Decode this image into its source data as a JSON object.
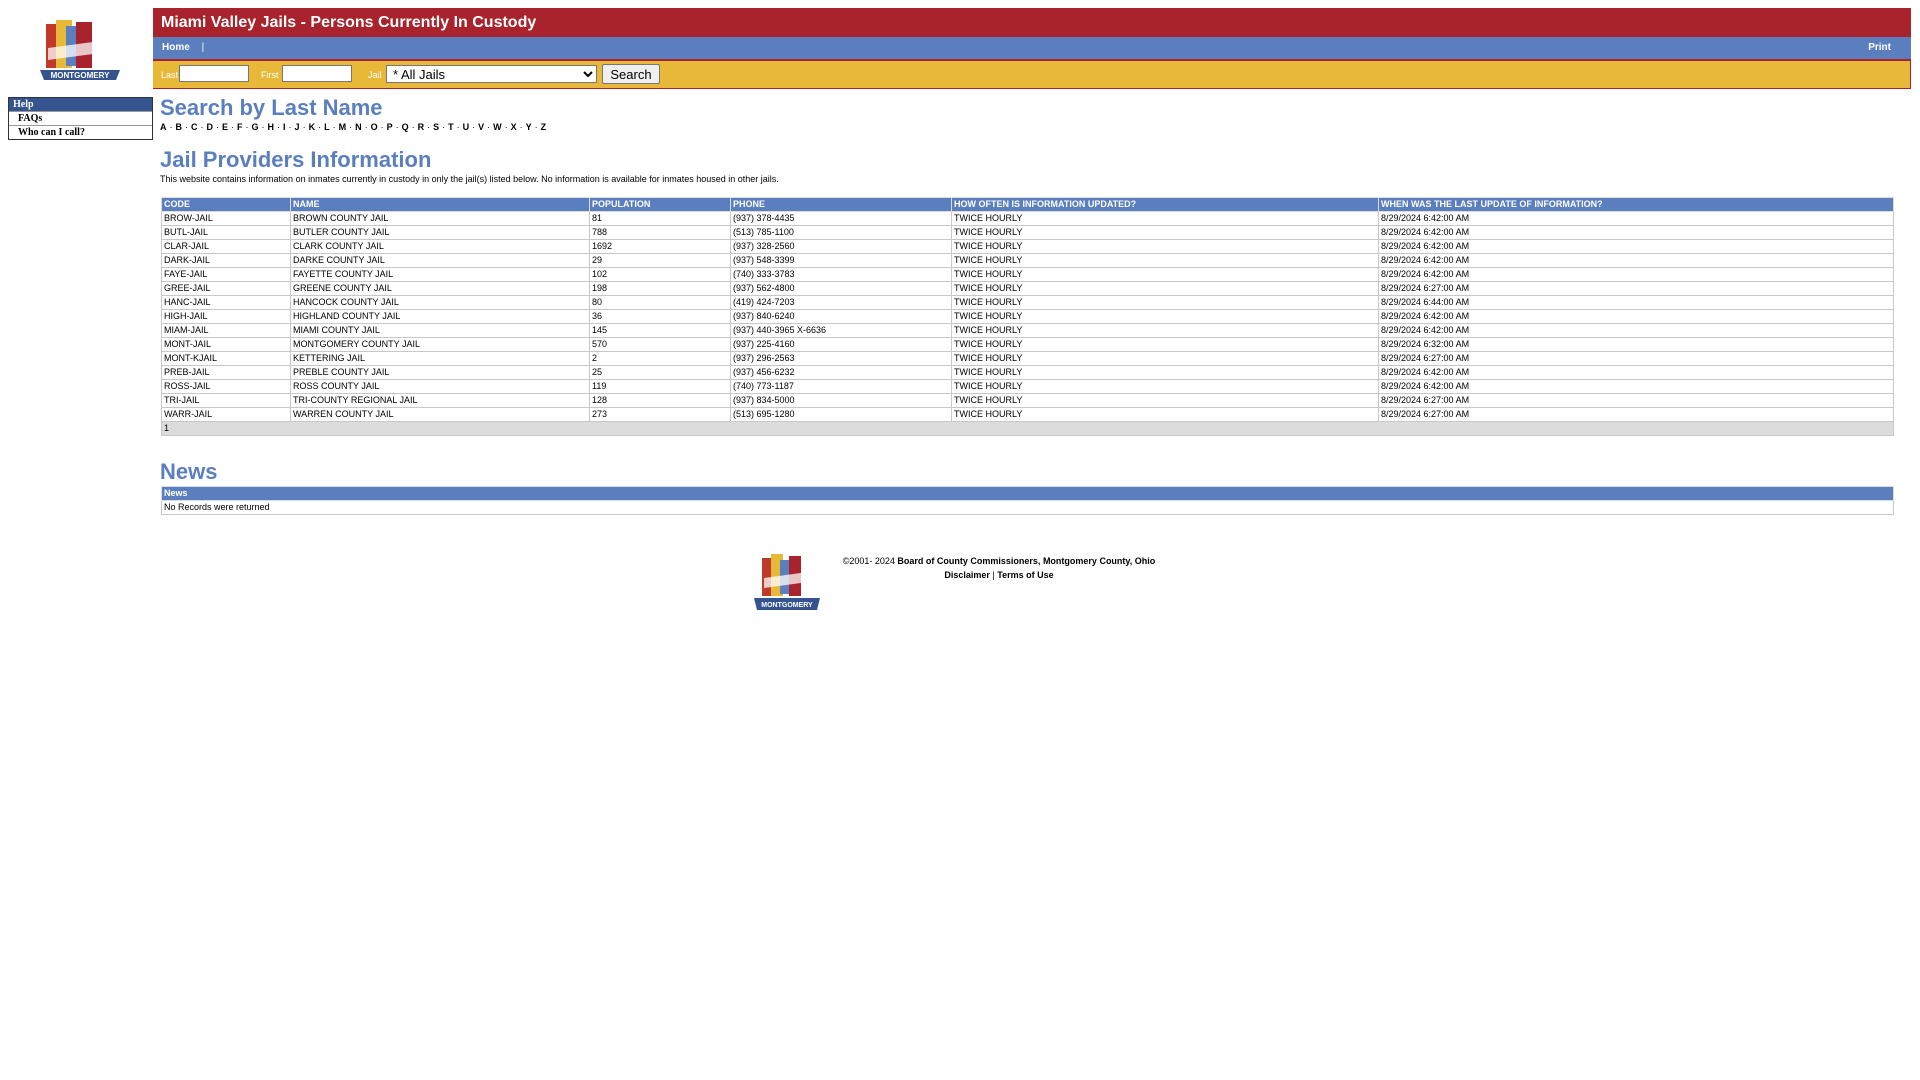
{
  "header": {
    "title": "Miami Valley Jails - Persons Currently In Custody",
    "logo_text": "MONTGOMERY"
  },
  "nav": {
    "home": "Home",
    "separator": "|",
    "print": "Print"
  },
  "search": {
    "last_label": "Last",
    "first_label": "First",
    "jail_label": "Jail",
    "jail_selected": "* All Jails",
    "button": "Search"
  },
  "side_menu": {
    "heading": "Help",
    "items": [
      "FAQs",
      "Who can I call?"
    ]
  },
  "search_by_name": {
    "heading": "Search by Last Name",
    "letters": [
      "A",
      "B",
      "C",
      "D",
      "E",
      "F",
      "G",
      "H",
      "I",
      "J",
      "K",
      "L",
      "M",
      "N",
      "O",
      "P",
      "Q",
      "R",
      "S",
      "T",
      "U",
      "V",
      "W",
      "X",
      "Y",
      "Z"
    ],
    "separator": "·"
  },
  "providers": {
    "heading": "Jail Providers Information",
    "description": "This website contains information on inmates currently in custody in only the jail(s) listed below. No information is available for inmates housed in other jails.",
    "columns": [
      "CODE",
      "NAME",
      "POPULATION",
      "PHONE",
      "HOW OFTEN IS INFORMATION UPDATED?",
      "WHEN WAS THE LAST UPDATE OF INFORMATION?"
    ],
    "rows": [
      [
        "BROW-JAIL",
        "BROWN COUNTY JAIL",
        "81",
        "(937) 378-4435",
        "TWICE HOURLY",
        "8/29/2024 6:42:00 AM"
      ],
      [
        "BUTL-JAIL",
        "BUTLER COUNTY JAIL",
        "788",
        "(513) 785-1100",
        "TWICE HOURLY",
        "8/29/2024 6:42:00 AM"
      ],
      [
        "CLAR-JAIL",
        "CLARK COUNTY JAIL",
        "1692",
        "(937) 328-2560",
        "TWICE HOURLY",
        "8/29/2024 6:42:00 AM"
      ],
      [
        "DARK-JAIL",
        "DARKE COUNTY JAIL",
        "29",
        "(937) 548-3399",
        "TWICE HOURLY",
        "8/29/2024 6:42:00 AM"
      ],
      [
        "FAYE-JAIL",
        "FAYETTE COUNTY JAIL",
        "102",
        "(740) 333-3783",
        "TWICE HOURLY",
        "8/29/2024 6:42:00 AM"
      ],
      [
        "GREE-JAIL",
        "GREENE COUNTY JAIL",
        "198",
        "(937) 562-4800",
        "TWICE HOURLY",
        "8/29/2024 6:27:00 AM"
      ],
      [
        "HANC-JAIL",
        "HANCOCK COUNTY JAIL",
        "80",
        "(419) 424-7203",
        "TWICE HOURLY",
        "8/29/2024 6:44:00 AM"
      ],
      [
        "HIGH-JAIL",
        "HIGHLAND COUNTY JAIL",
        "36",
        "(937) 840-6240",
        "TWICE HOURLY",
        "8/29/2024 6:42:00 AM"
      ],
      [
        "MIAM-JAIL",
        "MIAMI COUNTY JAIL",
        "145",
        "(937) 440-3965 X-6636",
        "TWICE HOURLY",
        "8/29/2024 6:42:00 AM"
      ],
      [
        "MONT-JAIL",
        "MONTGOMERY COUNTY JAIL",
        "570",
        "(937) 225-4160",
        "TWICE HOURLY",
        "8/29/2024 6:32:00 AM"
      ],
      [
        "MONT-KJAIL",
        "KETTERING JAIL",
        "2",
        "(937) 296-2563",
        "TWICE HOURLY",
        "8/29/2024 6:27:00 AM"
      ],
      [
        "PREB-JAIL",
        "PREBLE COUNTY JAIL",
        "25",
        "(937) 456-6232",
        "TWICE HOURLY",
        "8/29/2024 6:42:00 AM"
      ],
      [
        "ROSS-JAIL",
        "ROSS COUNTY JAIL",
        "119",
        "(740) 773-1187",
        "TWICE HOURLY",
        "8/29/2024 6:42:00 AM"
      ],
      [
        "TRI-JAIL",
        "TRI-COUNTY REGIONAL JAIL",
        "128",
        "(937) 834-5000",
        "TWICE HOURLY",
        "8/29/2024 6:27:00 AM"
      ],
      [
        "WARR-JAIL",
        "WARREN COUNTY JAIL",
        "273",
        "(513) 695-1280",
        "TWICE HOURLY",
        "8/29/2024 6:27:00 AM"
      ]
    ],
    "pager": "1"
  },
  "news": {
    "heading": "News",
    "column": "News",
    "empty": "No Records were returned"
  },
  "footer": {
    "copyright": "©2001- 2024",
    "org": "Board of County Commissioners, Montgomery County, Ohio",
    "disclaimer": "Disclaimer",
    "separator": "|",
    "terms": "Terms of Use"
  },
  "colors": {
    "header_red": "#a8232b",
    "nav_blue": "#5b7fbe",
    "search_gold": "#e8b839",
    "menu_head_blue": "#35538f"
  },
  "icons": {
    "logo": "montgomery-county-logo"
  }
}
